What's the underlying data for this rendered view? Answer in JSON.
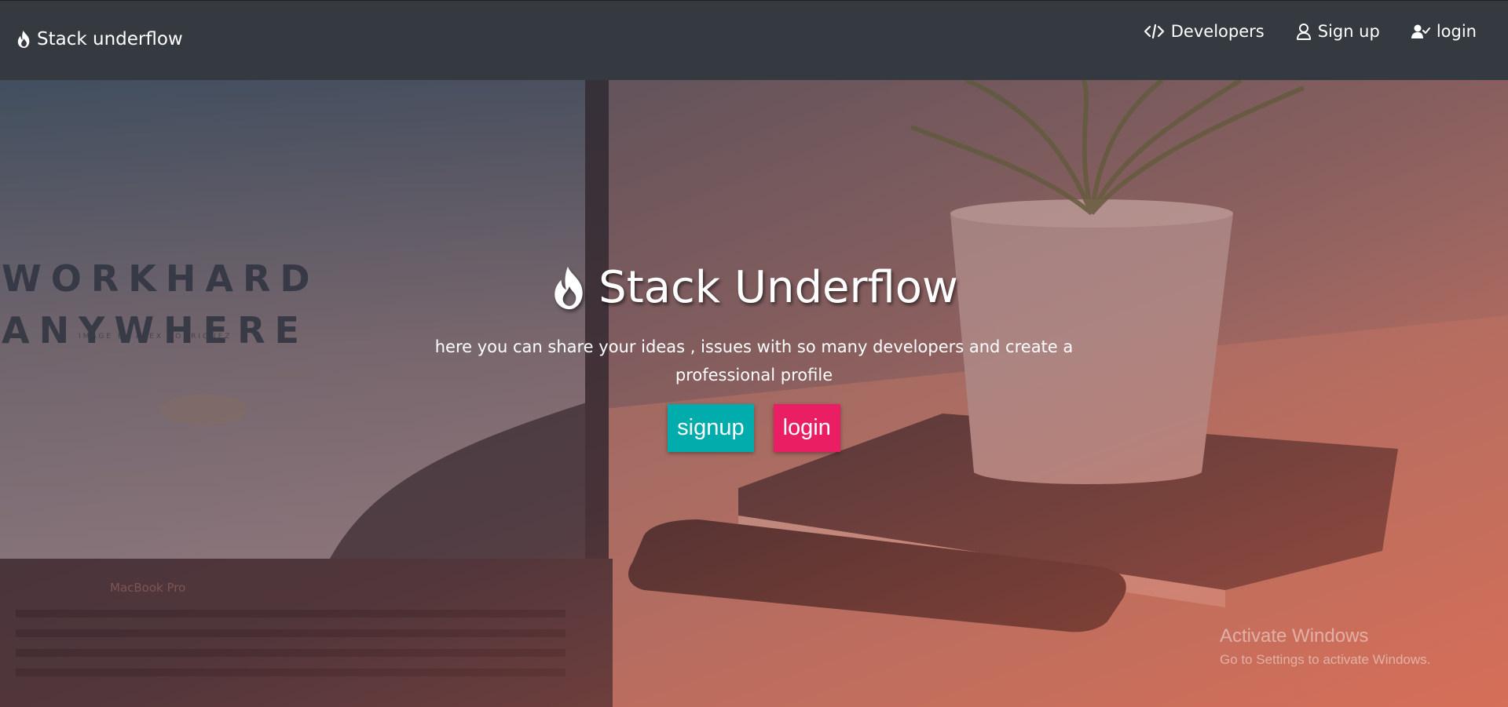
{
  "navbar": {
    "brand": "Stack underflow",
    "links": [
      {
        "label": "Developers",
        "icon": "code-icon"
      },
      {
        "label": "Sign up",
        "icon": "user-icon"
      },
      {
        "label": "login",
        "icon": "user-check-icon"
      }
    ]
  },
  "background": {
    "laptop_line1": "WORKHARD",
    "laptop_line2": "ANYWHERE",
    "laptop_credit": "IMAGE BY ALEX RODRIGUEZ",
    "laptop_label": "MacBook Pro"
  },
  "hero": {
    "title": "Stack Underflow",
    "icon": "flame-icon",
    "description": "here you can share your ideas , issues with so many developers and create a professional profile",
    "signup_label": "signup",
    "login_label": "login"
  },
  "colors": {
    "navbar": "#343a40",
    "signup_button": "#00acac",
    "login_button": "#e91e63"
  },
  "watermark": {
    "title": "Activate Windows",
    "subtitle": "Go to Settings to activate Windows."
  }
}
